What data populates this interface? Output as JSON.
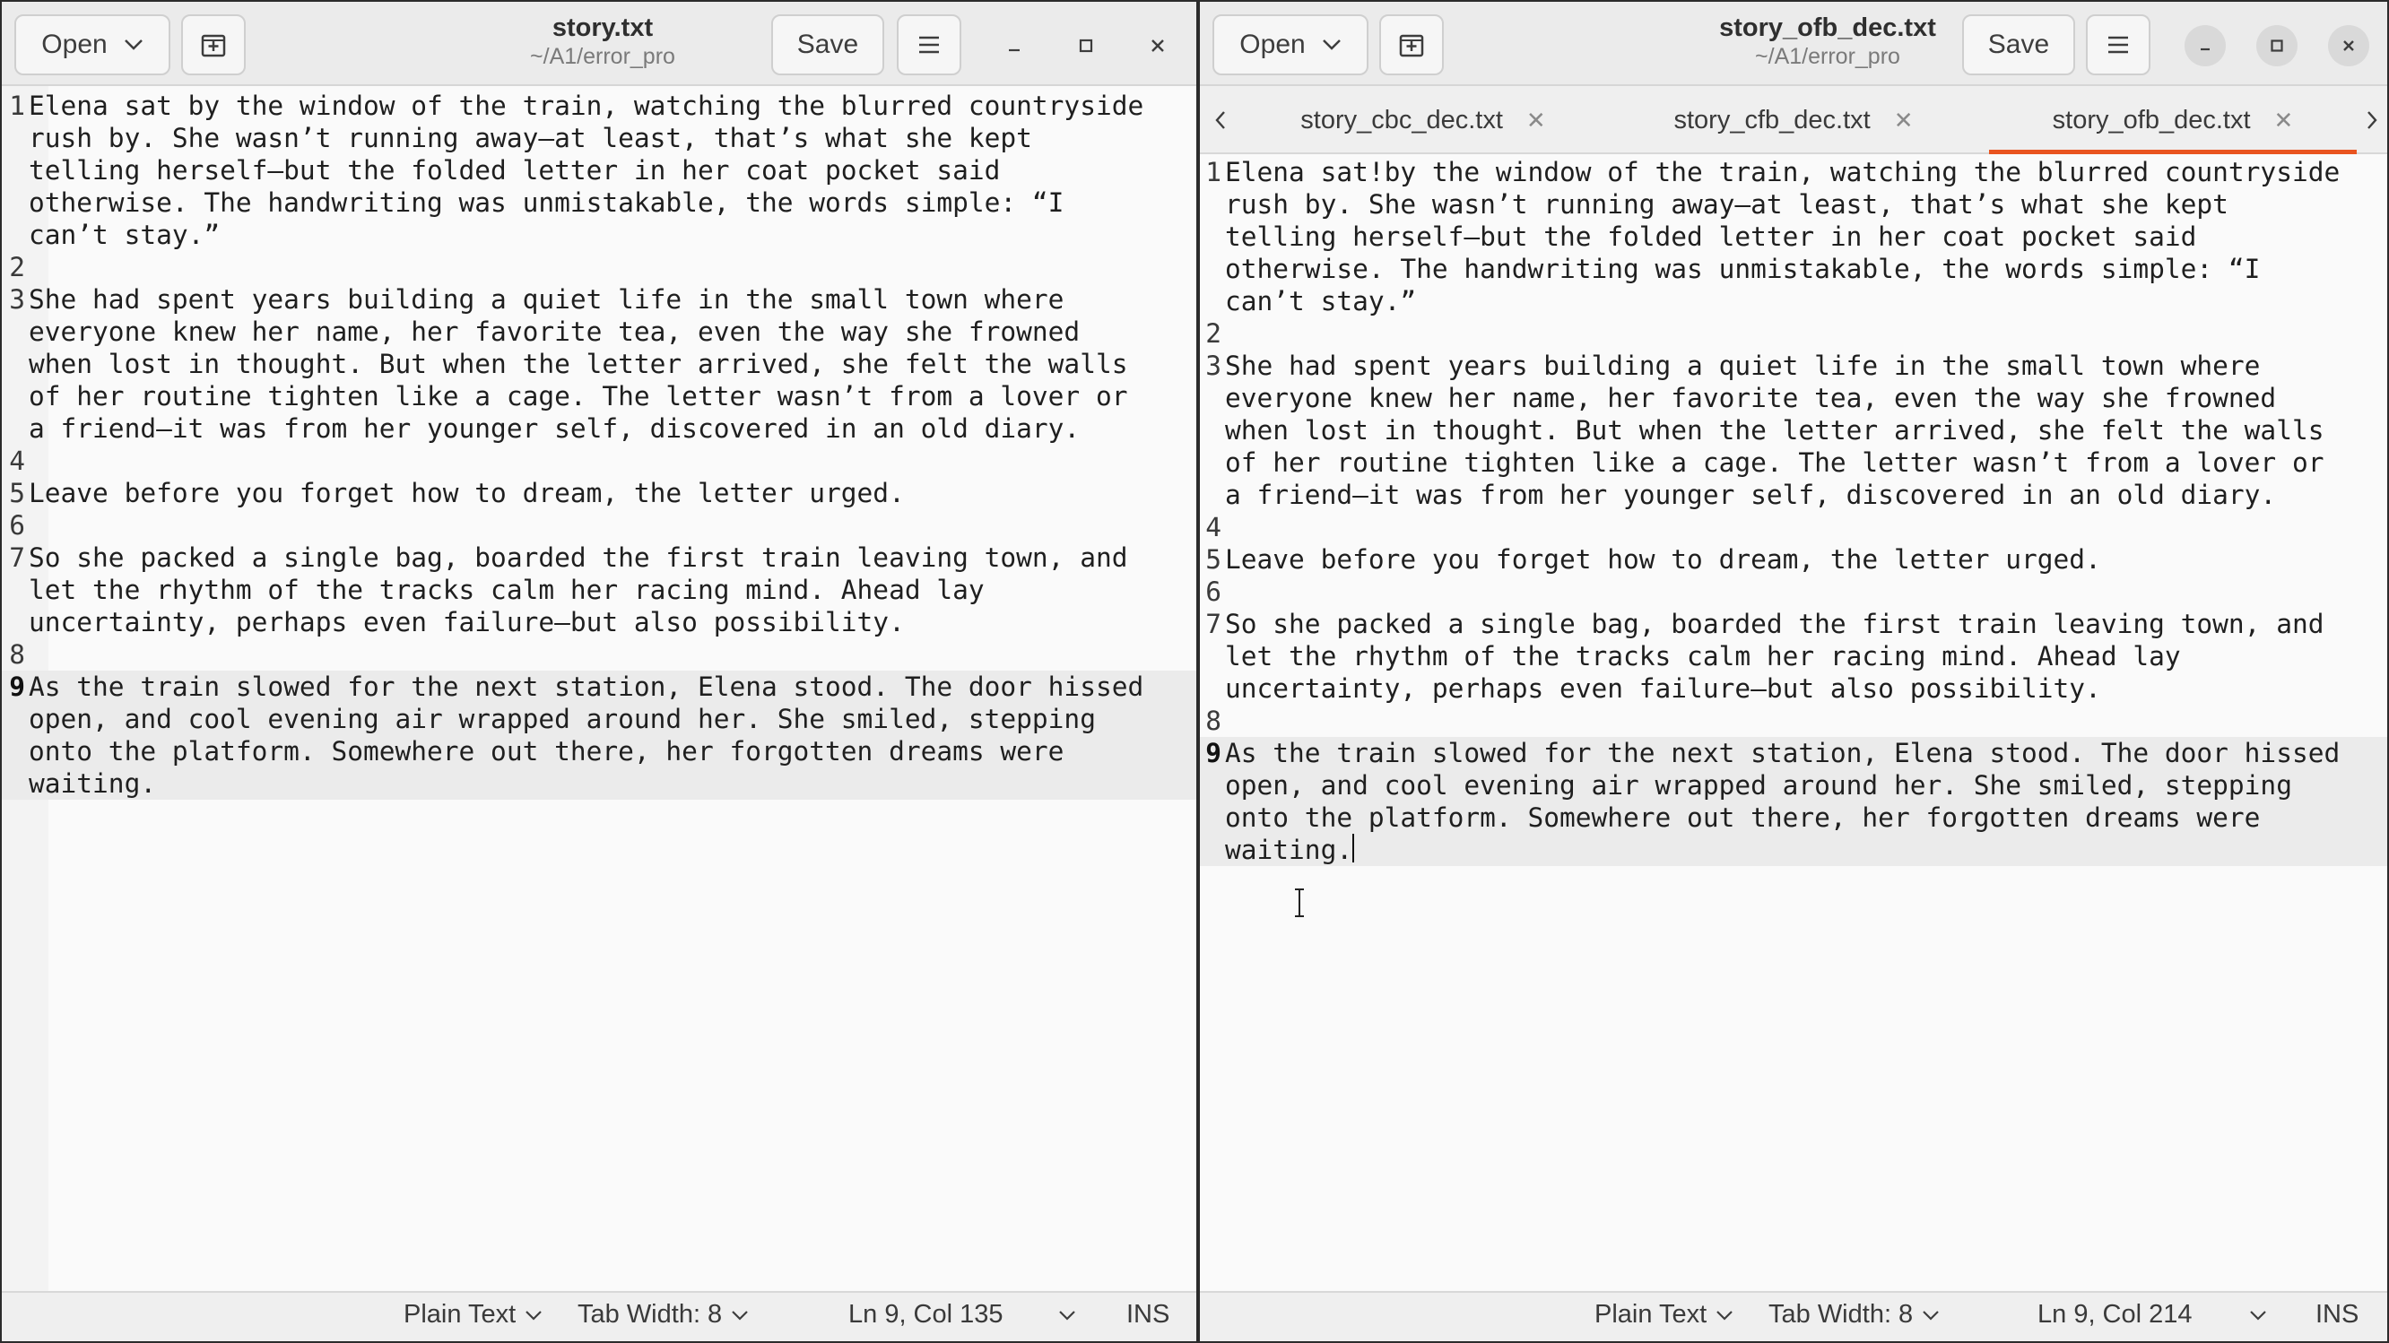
{
  "left": {
    "open_label": "Open",
    "title": "story.txt",
    "subtitle": "~/A1/error_pro",
    "save_label": "Save",
    "lines": [
      {
        "n": "1",
        "wraps": [
          "Elena sat by the window of the train, watching the blurred countryside",
          "rush by. She wasn’t running away—at least, that’s what she kept",
          "telling herself—but the folded letter in her coat pocket said",
          "otherwise. The handwriting was unmistakable, the words simple: “I",
          "can’t stay.”"
        ]
      },
      {
        "n": "2",
        "wraps": [
          ""
        ]
      },
      {
        "n": "3",
        "wraps": [
          "She had spent years building a quiet life in the small town where",
          "everyone knew her name, her favorite tea, even the way she frowned",
          "when lost in thought. But when the letter arrived, she felt the walls",
          "of her routine tighten like a cage. The letter wasn’t from a lover or",
          "a friend—it was from her younger self, discovered in an old diary."
        ]
      },
      {
        "n": "4",
        "wraps": [
          ""
        ]
      },
      {
        "n": "5",
        "wraps": [
          "Leave before you forget how to dream, the letter urged."
        ]
      },
      {
        "n": "6",
        "wraps": [
          ""
        ]
      },
      {
        "n": "7",
        "wraps": [
          "So she packed a single bag, boarded the first train leaving town, and",
          "let the rhythm of the tracks calm her racing mind. Ahead lay",
          "uncertainty, perhaps even failure—but also possibility."
        ]
      },
      {
        "n": "8",
        "wraps": [
          ""
        ]
      },
      {
        "n": "9",
        "current": true,
        "wraps": [
          "As the train slowed for the next station, Elena stood. The door hissed",
          "open, and cool evening air wrapped around her. She smiled, stepping",
          "onto the platform. Somewhere out there, her forgotten dreams were",
          "waiting."
        ]
      }
    ],
    "status": {
      "lang": "Plain Text",
      "tab_width": "Tab Width: 8",
      "position": "Ln 9, Col 135",
      "mode": "INS"
    }
  },
  "right": {
    "open_label": "Open",
    "title": "story_ofb_dec.txt",
    "subtitle": "~/A1/error_pro",
    "save_label": "Save",
    "tabs": [
      {
        "label": "story_cbc_dec.txt",
        "active": false
      },
      {
        "label": "story_cfb_dec.txt",
        "active": false
      },
      {
        "label": "story_ofb_dec.txt",
        "active": true
      }
    ],
    "lines": [
      {
        "n": "1",
        "wraps": [
          "Elena sat!by the window of the train, watching the blurred countryside",
          "rush by. She wasn’t running away—at least, that’s what she kept",
          "telling herself—but the folded letter in her coat pocket said",
          "otherwise. The handwriting was unmistakable, the words simple: “I",
          "can’t stay.”"
        ]
      },
      {
        "n": "2",
        "wraps": [
          ""
        ]
      },
      {
        "n": "3",
        "wraps": [
          "She had spent years building a quiet life in the small town where",
          "everyone knew her name, her favorite tea, even the way she frowned",
          "when lost in thought. But when the letter arrived, she felt the walls",
          "of her routine tighten like a cage. The letter wasn’t from a lover or",
          "a friend—it was from her younger self, discovered in an old diary."
        ]
      },
      {
        "n": "4",
        "wraps": [
          ""
        ]
      },
      {
        "n": "5",
        "wraps": [
          "Leave before you forget how to dream, the letter urged."
        ]
      },
      {
        "n": "6",
        "wraps": [
          ""
        ]
      },
      {
        "n": "7",
        "wraps": [
          "So she packed a single bag, boarded the first train leaving town, and",
          "let the rhythm of the tracks calm her racing mind. Ahead lay",
          "uncertainty, perhaps even failure—but also possibility."
        ]
      },
      {
        "n": "8",
        "wraps": [
          ""
        ]
      },
      {
        "n": "9",
        "current": true,
        "caret": true,
        "wraps": [
          "As the train slowed for the next station, Elena stood. The door hissed",
          "open, and cool evening air wrapped around her. She smiled, stepping",
          "onto the platform. Somewhere out there, her forgotten dreams were",
          "waiting."
        ]
      }
    ],
    "status": {
      "lang": "Plain Text",
      "tab_width": "Tab Width: 8",
      "position": "Ln 9, Col 214",
      "mode": "INS"
    }
  },
  "colors": {
    "accent": "#e95420",
    "current_line": "#ebebeb",
    "header": "#ebebeb"
  }
}
